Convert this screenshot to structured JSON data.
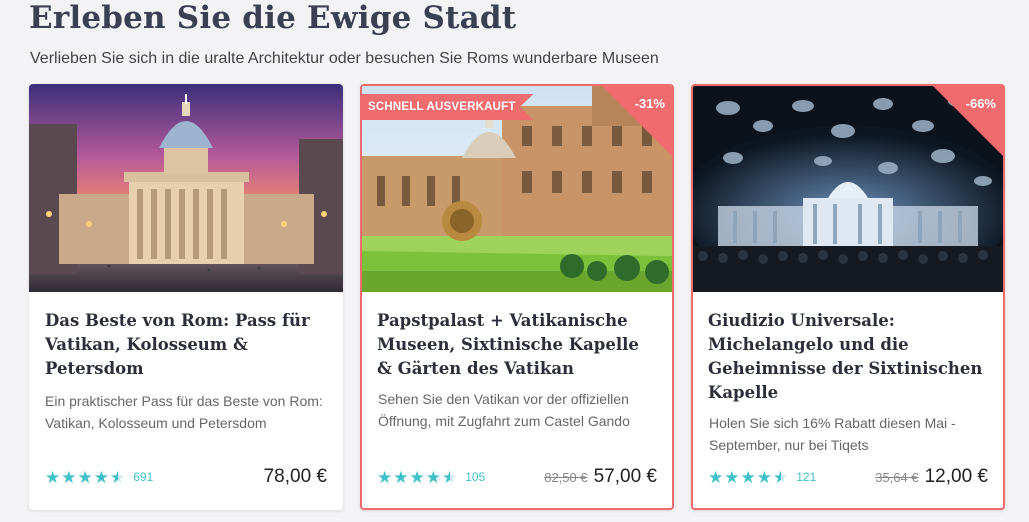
{
  "section": {
    "title": "Erleben Sie die Ewige Stadt",
    "subtitle": "Verlieben Sie sich in die uralte Architektur oder besuchen Sie Roms wunderbare Museen"
  },
  "colors": {
    "accent": "#ef6b6e",
    "stars": "#3fc1c9",
    "heading": "#3a3f51"
  },
  "cards": [
    {
      "title": "Das Beste von Rom: Pass für Vatikan, Kolosseum & Petersdom",
      "description": "Ein praktischer Pass für das Beste von Rom: Vatikan, Kolosseum und Petersdom",
      "rating": 4.5,
      "reviews": "691",
      "old_price": "",
      "price": "78,00 €",
      "badge": "",
      "discount": ""
    },
    {
      "title": "Papstpalast + Vatikanische Museen, Sixtinische Kapelle & Gärten des Vatikan",
      "description": "Sehen Sie den Vatikan vor der offiziellen Öffnung, mit Zugfahrt zum Castel Gando",
      "rating": 4.5,
      "reviews": "105",
      "old_price": "82,50 €",
      "price": "57,00 €",
      "badge": "SCHNELL AUSVERKAUFT",
      "discount": "-31%"
    },
    {
      "title": "Giudizio Universale: Michelangelo und die Geheimnisse der Sixtinischen Kapelle",
      "description": "Holen Sie sich 16% Rabatt diesen Mai - September, nur bei Tiqets",
      "rating": 4.5,
      "reviews": "121",
      "old_price": "35,64 €",
      "price": "12,00 €",
      "badge": "",
      "discount": "-66%"
    }
  ]
}
